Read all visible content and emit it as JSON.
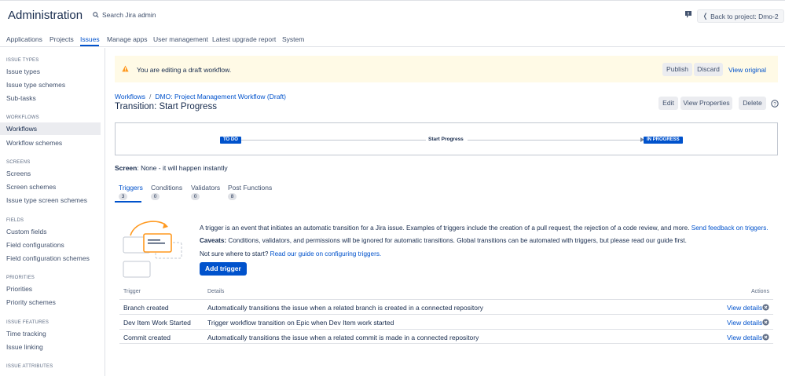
{
  "header": {
    "app_title": "Administration",
    "search_placeholder": "Search Jira admin",
    "back_button": "Back to project: Dmo-2"
  },
  "nav_tabs": [
    "Applications",
    "Projects",
    "Issues",
    "Manage apps",
    "User management",
    "Latest upgrade report",
    "System"
  ],
  "active_tab": "Issues",
  "sidebar": {
    "sections": [
      {
        "heading": "ISSUE TYPES",
        "items": [
          "Issue types",
          "Issue type schemes",
          "Sub-tasks"
        ]
      },
      {
        "heading": "WORKFLOWS",
        "items": [
          "Workflows",
          "Workflow schemes"
        ]
      },
      {
        "heading": "SCREENS",
        "items": [
          "Screens",
          "Screen schemes",
          "Issue type screen schemes"
        ]
      },
      {
        "heading": "FIELDS",
        "items": [
          "Custom fields",
          "Field configurations",
          "Field configuration schemes"
        ]
      },
      {
        "heading": "PRIORITIES",
        "items": [
          "Priorities",
          "Priority schemes"
        ]
      },
      {
        "heading": "ISSUE FEATURES",
        "items": [
          "Time tracking",
          "Issue linking"
        ]
      },
      {
        "heading": "ISSUE ATTRIBUTES",
        "items": []
      }
    ],
    "active_item": "Workflows"
  },
  "banner": {
    "message": "You are editing a draft workflow.",
    "publish": "Publish",
    "discard": "Discard",
    "view_original": "View original"
  },
  "breadcrumb": {
    "root": "Workflows",
    "separator": "/",
    "current": "DMO: Project Management Workflow (Draft)"
  },
  "page_title": "Transition: Start Progress",
  "page_actions": {
    "edit": "Edit",
    "view_properties": "View Properties",
    "delete": "Delete"
  },
  "diagram": {
    "from_status": "TO DO",
    "transition": "Start Progress",
    "to_status": "IN PROGRESS"
  },
  "screen_info": {
    "label": "Screen",
    "value": ": None - it will happen instantly"
  },
  "panel_tabs": [
    {
      "label": "Triggers",
      "count": "3"
    },
    {
      "label": "Conditions",
      "count": "0"
    },
    {
      "label": "Validators",
      "count": "0"
    },
    {
      "label": "Post Functions",
      "count": "8"
    }
  ],
  "triggers_info": {
    "intro": "A trigger is an event that initiates an automatic transition for a Jira issue. Examples of triggers include the creation of a pull request, the rejection of a code review, and more.",
    "feedback_link": "Send feedback on triggers.",
    "caveats_label": "Caveats:",
    "caveats_text": "Conditions, validators, and permissions will be ignored for automatic transitions. Global transitions can be automated with triggers, but please read our guide first.",
    "not_sure": "Not sure where to start?",
    "guide_link": "Read our guide on configuring triggers.",
    "add_trigger": "Add trigger"
  },
  "table": {
    "headers": {
      "trigger": "Trigger",
      "details": "Details",
      "actions": "Actions"
    },
    "rows": [
      {
        "trigger": "Branch created",
        "details": "Automatically transitions the issue when a related branch is created in a connected repository",
        "action": "View details"
      },
      {
        "trigger": "Dev Item Work Started",
        "details": "Trigger workflow transition on Epic when Dev Item work started",
        "action": "View details"
      },
      {
        "trigger": "Commit created",
        "details": "Automatically transitions the issue when a related commit is made in a connected repository",
        "action": "View details"
      }
    ]
  },
  "colors": {
    "primary": "#0052cc",
    "banner_bg": "#fffae6",
    "warning": "#ff991f",
    "sidebar_active": "#ebecf0"
  }
}
